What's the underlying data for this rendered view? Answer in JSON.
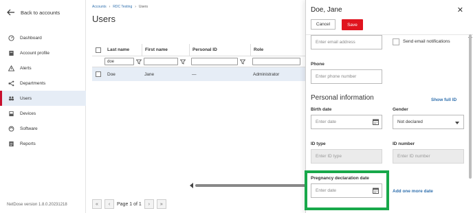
{
  "sidebar": {
    "back_label": "Back to accounts",
    "items": [
      {
        "label": "Dashboard",
        "icon": "dashboard-icon",
        "active": false
      },
      {
        "label": "Account profile",
        "icon": "account-profile-icon",
        "active": false
      },
      {
        "label": "Alerts",
        "icon": "alert-icon",
        "active": false
      },
      {
        "label": "Departments",
        "icon": "departments-icon",
        "active": false
      },
      {
        "label": "Users",
        "icon": "users-icon",
        "active": true
      },
      {
        "label": "Devices",
        "icon": "devices-icon",
        "active": false
      },
      {
        "label": "Software",
        "icon": "software-icon",
        "active": false
      },
      {
        "label": "Reports",
        "icon": "reports-icon",
        "active": false
      }
    ],
    "version": "NetDose version 1.8.0.20231218"
  },
  "breadcrumb": [
    "Accounts",
    "RDC Testing",
    "Users"
  ],
  "page_title": "Users",
  "table": {
    "headers": [
      "Last name",
      "First name",
      "Personal ID",
      "Role"
    ],
    "filter_last_name": "doe",
    "rows": [
      {
        "last_name": "Doe",
        "first_name": "Jane",
        "personal_id": "—",
        "role": "Administrator"
      }
    ]
  },
  "pager": {
    "label": "Page 1 of 1"
  },
  "drawer": {
    "title": "Doe, Jane",
    "cancel_label": "Cancel",
    "save_label": "Save",
    "email_placeholder": "Enter email address",
    "send_email_label": "Send email notifications",
    "phone_label": "Phone",
    "phone_placeholder": "Enter phone number",
    "section_title": "Personal information",
    "show_full_id": "Show full ID",
    "birth_date_label": "Birth date",
    "birth_date_placeholder": "Enter date",
    "gender_label": "Gender",
    "gender_value": "Not declared",
    "id_type_label": "ID type",
    "id_type_placeholder": "Enter ID type",
    "id_number_label": "ID number",
    "id_number_placeholder": "Enter ID number",
    "pregnancy_label": "Pregnancy declaration date",
    "pregnancy_placeholder": "Enter date",
    "add_date_link": "Add one more date"
  },
  "colors": {
    "accent": "#2f6fad",
    "save": "#e0141e",
    "highlight": "#18a84a",
    "active_nav": "#c8102e"
  }
}
